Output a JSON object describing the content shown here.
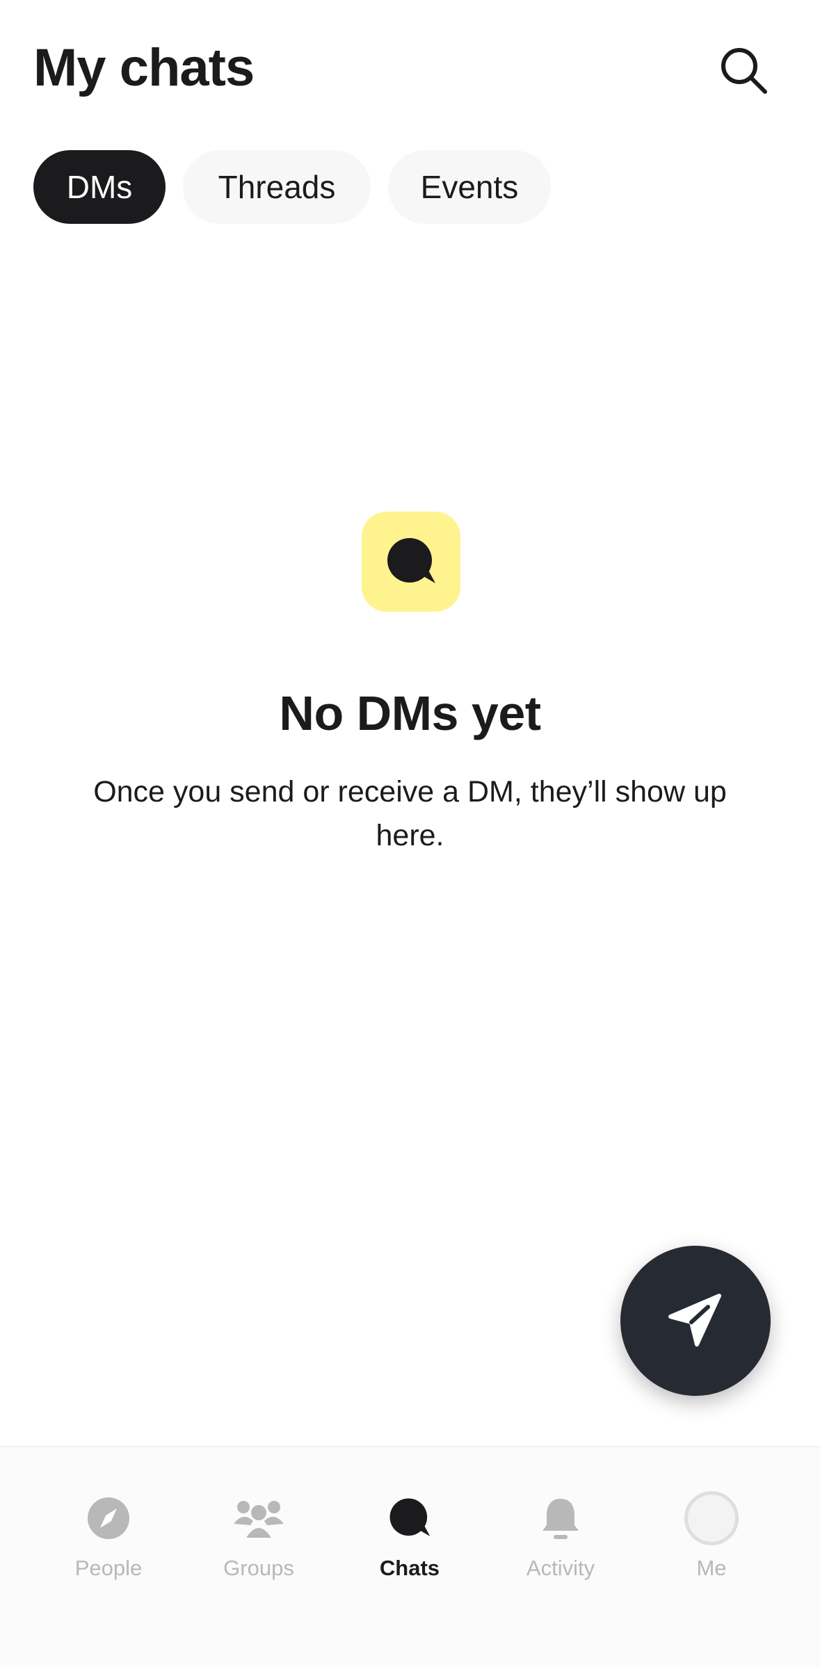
{
  "header": {
    "title": "My chats"
  },
  "tabs": [
    {
      "label": "DMs"
    },
    {
      "label": "Threads"
    },
    {
      "label": "Events"
    }
  ],
  "empty_state": {
    "title": "No DMs yet",
    "subtitle": "Once you send or receive a DM, they’ll show up here."
  },
  "bottom_nav": [
    {
      "label": "People",
      "icon": "compass-icon"
    },
    {
      "label": "Groups",
      "icon": "group-icon"
    },
    {
      "label": "Chats",
      "icon": "chat-bubble-icon"
    },
    {
      "label": "Activity",
      "icon": "bell-icon"
    },
    {
      "label": "Me",
      "icon": "avatar"
    }
  ],
  "colors": {
    "accent_yellow": "#fff38f",
    "dark": "#1b1b1d",
    "fab": "#262a33",
    "inactive": "#b8b8b8"
  }
}
